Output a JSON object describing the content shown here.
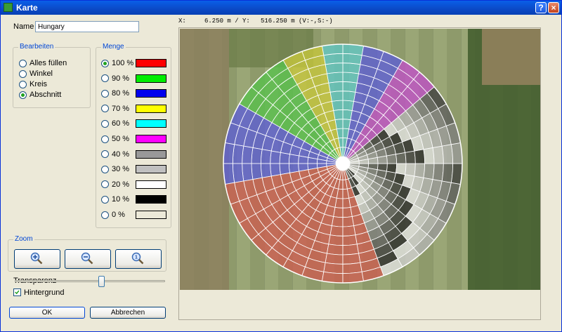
{
  "window": {
    "title": "Karte",
    "help_label": "?",
    "close_label": "×"
  },
  "name_field": {
    "label": "Name",
    "value": "Hungary"
  },
  "edit_group": {
    "title": "Bearbeiten",
    "options": [
      {
        "label": "Alles füllen",
        "checked": false
      },
      {
        "label": "Winkel",
        "checked": false
      },
      {
        "label": "Kreis",
        "checked": false
      },
      {
        "label": "Abschnitt",
        "checked": true
      }
    ]
  },
  "amount_group": {
    "title": "Menge",
    "levels": [
      {
        "label": "100 %",
        "color": "#ff0000",
        "checked": true
      },
      {
        "label": "90 %",
        "color": "#00ee00",
        "checked": false
      },
      {
        "label": "80 %",
        "color": "#0000ee",
        "checked": false
      },
      {
        "label": "70 %",
        "color": "#ffff00",
        "checked": false
      },
      {
        "label": "60 %",
        "color": "#00ffff",
        "checked": false
      },
      {
        "label": "50 %",
        "color": "#ff00ff",
        "checked": false
      },
      {
        "label": "40 %",
        "color": "#999999",
        "checked": false
      },
      {
        "label": "30 %",
        "color": "#c0c0c0",
        "checked": false
      },
      {
        "label": "20 %",
        "color": "#ffffff",
        "checked": false
      },
      {
        "label": "10 %",
        "color": "#000000",
        "checked": false
      },
      {
        "label": "0 %",
        "color": "#ece9d8",
        "checked": false
      }
    ]
  },
  "zoom_group": {
    "title": "Zoom",
    "buttons": [
      "zoom-in-icon",
      "zoom-out-icon",
      "zoom-reset-icon"
    ]
  },
  "transparency": {
    "label": "Transparenz",
    "value": 0.58
  },
  "background_checkbox": {
    "label": "Hintergrund",
    "checked": true
  },
  "buttons": {
    "ok": "OK",
    "cancel": "Abbrechen"
  },
  "coordinates": {
    "x_label": "X:",
    "x_value": "6.250 m / Y:",
    "y_value": "516.250 m (V:-,S:-)"
  },
  "map": {
    "rings": 12,
    "palette": {
      "red": "#cd5c4f",
      "green": "#57c24b",
      "blue": "#5c5ed6",
      "yellow": "#c8c83c",
      "cyan": "#5fc7c4",
      "magenta": "#c04fc8"
    },
    "sectors": [
      {
        "from": 80,
        "to": 100,
        "color": "cyan"
      },
      {
        "from": 100,
        "to": 120,
        "color": "yellow"
      },
      {
        "from": 120,
        "to": 150,
        "color": "green"
      },
      {
        "from": 150,
        "to": 170,
        "color": "blue"
      },
      {
        "from": 170,
        "to": 190,
        "color": "blue"
      },
      {
        "from": 190,
        "to": 250,
        "color": "red"
      },
      {
        "from": 250,
        "to": 290,
        "color": "red"
      },
      {
        "from": 290,
        "to": 320,
        "color": "gray"
      },
      {
        "from": 320,
        "to": 360,
        "color": "gray"
      },
      {
        "from": 0,
        "to": 40,
        "color": "gray"
      },
      {
        "from": 40,
        "to": 60,
        "color": "magenta"
      },
      {
        "from": 60,
        "to": 80,
        "color": "blue"
      }
    ]
  }
}
